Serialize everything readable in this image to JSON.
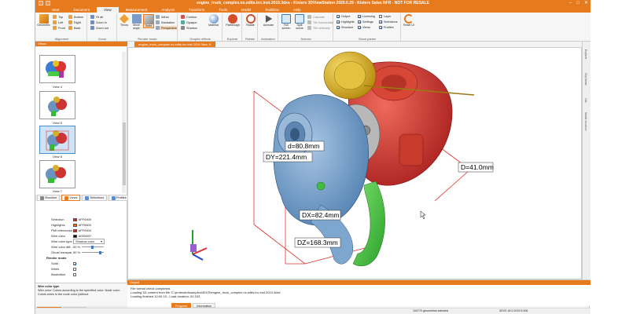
{
  "title": "engine_truck_complex.nx.edits.inc.inst.2019.3dxs - Kisters 3DViewStation 2020.0.29 - Kisters Sales NFR - NOT FOR RESALE",
  "menu": [
    "Start",
    "Document",
    "View",
    "Measurement",
    "Analysis",
    "Transform",
    "Tools",
    "Model",
    "TextilDoc",
    "Help"
  ],
  "active_menu": "View",
  "ribbon": {
    "alignment": {
      "label": "Alignment",
      "geometric_label": "Geometric",
      "items": [
        "Top",
        "Left",
        "Front",
        "Bottom",
        "Right",
        "Back"
      ]
    },
    "zoom": {
      "label": "Zoom",
      "items": [
        "Fit all",
        "Zoom in",
        "Zoom out"
      ]
    },
    "render": {
      "label": "Render mode",
      "buttons": [
        "Throw",
        "Move angle",
        "Solid"
      ],
      "items": [
        "Wires",
        "Illustration",
        "Perspective"
      ]
    },
    "effects": {
      "label": "Graphic effects",
      "items": [
        "Contour",
        "Opaque",
        "Shadow"
      ],
      "big": "Material"
    },
    "explore": {
      "label": "Explore",
      "button": "Pathtrough"
    },
    "rotate": {
      "label": "Rotate",
      "button": "Rotate"
    },
    "animation": {
      "label": "Animation",
      "button": "Animate"
    },
    "scenes": {
      "label": "Scenes",
      "buttons": [
        "Full screen",
        "Split scene"
      ],
      "items": [
        "Cascade",
        "Tile horizontally",
        "Tile vertically"
      ]
    },
    "panes": {
      "label": "Show panes",
      "col1": [
        "Output",
        "Highlights",
        "Structure"
      ],
      "col2": [
        "Licensing",
        "Settings",
        "Views"
      ],
      "col3": [
        "Layer",
        "Selections",
        "Profiles"
      ]
    },
    "reset": "Reset UI"
  },
  "views_pane": {
    "title": "Views",
    "items": [
      "View 4",
      "View 5",
      "View 6",
      "View 7"
    ]
  },
  "panel_tabs": [
    "Structure",
    "Views",
    "Selections",
    "Profiles"
  ],
  "properties": {
    "title": "Properties",
    "rows": [
      {
        "key": "Selection",
        "value": "#FF0000",
        "color": "#e02020"
      },
      {
        "key": "Highlights",
        "value": "#FF6600",
        "color": "#ff6600"
      },
      {
        "key": "PMI references",
        "value": "#FF0000",
        "color": "#e02020"
      },
      {
        "key": "Wire color",
        "value": "#000000",
        "color": "#000000"
      },
      {
        "key": "Wire color type",
        "value": "Shadow color"
      },
      {
        "key": "Wire color diff...",
        "value": "50 %"
      },
      {
        "key": "Ghost transpar...",
        "value": "50 %"
      },
      {
        "key": "Render mode",
        "value": ""
      },
      {
        "key": "Solid",
        "value": ""
      },
      {
        "key": "Wires",
        "value": ""
      },
      {
        "key": "Illustration",
        "value": ""
      }
    ],
    "desc_title": "Wire color type",
    "desc_text": "Wire color: Colors according to the specified color. Node color: Colors wires in the node color (without"
  },
  "bottom_tabs": [
    "Properties",
    "Licensing"
  ],
  "document_tab": "engine_truck_complex.nx.edits.inc.inst.2019.3dxs",
  "dimensions": [
    "d=80.8mm",
    "DY=221.4mm",
    "D=41.0mm",
    "DX=82.4mm",
    "DZ=168.3mm"
  ],
  "right_tabs": [
    "Explorer",
    "Clip frame",
    "Info",
    "Model structure"
  ],
  "output": {
    "title": "Output",
    "lines": [
      "File format check completed.",
      "Loading 3D content from file 'C:\\protected\\samples\\3DVS\\engine_truck_complex.nx.edits.inc.inst.2019.3dxs'",
      "Loading finished 10:00:19 - Load duration: 00.153"
    ],
    "tabs": [
      "Progress",
      "Information"
    ]
  },
  "status": {
    "left": "104770 geometries selected",
    "right": "3DVS 16.0.2019.5.006"
  },
  "colors": {
    "accent": "#e87a1e"
  }
}
